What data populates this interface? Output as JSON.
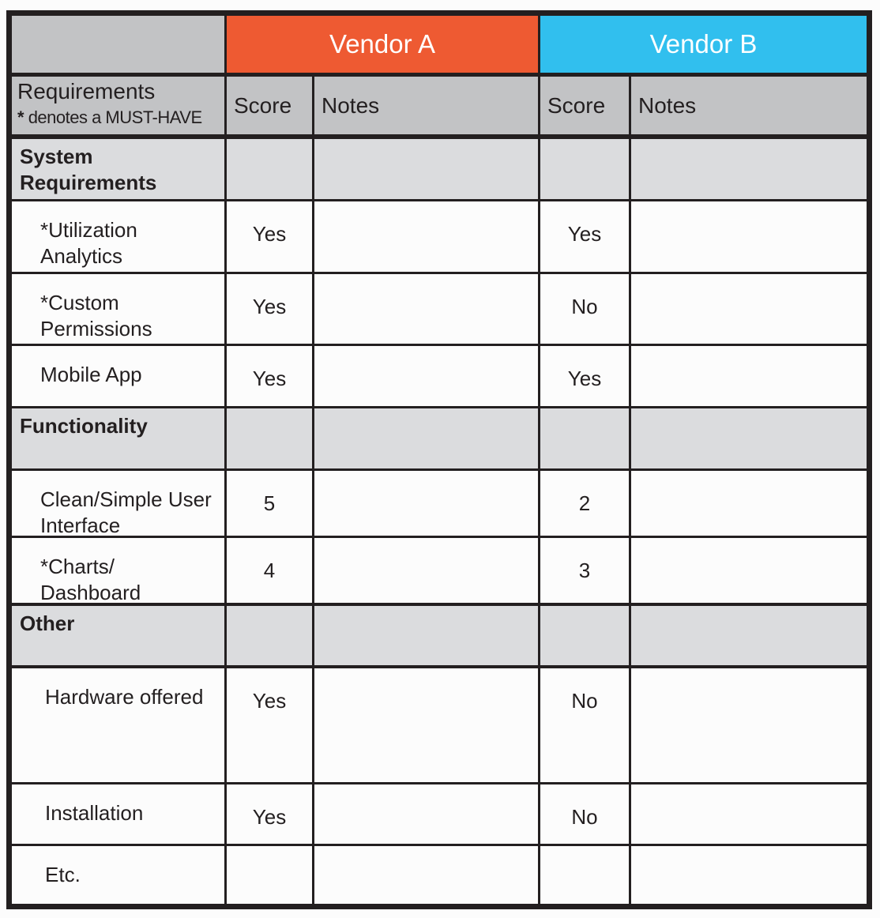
{
  "colors": {
    "vendor_a": "#ee5a32",
    "vendor_b": "#31bfee",
    "header_gray": "#c2c3c5",
    "section_gray": "#dbdcde",
    "border": "#231f20"
  },
  "vendors": [
    {
      "name": "Vendor A"
    },
    {
      "name": "Vendor B"
    }
  ],
  "columns": {
    "requirements": "Requirements",
    "must_have_marker": "*",
    "must_have_note": "denotes a MUST-HAVE",
    "score": "Score",
    "notes": "Notes"
  },
  "rows": [
    {
      "type": "section",
      "label": "System Requirements"
    },
    {
      "type": "item",
      "label_line1": "*Utilization",
      "label_line2": "Analytics",
      "vendor_a_score": "Yes",
      "vendor_a_notes": "",
      "vendor_b_score": "Yes",
      "vendor_b_notes": ""
    },
    {
      "type": "item",
      "label_line1": "*Custom",
      "label_line2": "Permissions",
      "vendor_a_score": "Yes",
      "vendor_a_notes": "",
      "vendor_b_score": "No",
      "vendor_b_notes": ""
    },
    {
      "type": "item",
      "label_line1": "Mobile App",
      "label_line2": "",
      "vendor_a_score": "Yes",
      "vendor_a_notes": "",
      "vendor_b_score": "Yes",
      "vendor_b_notes": ""
    },
    {
      "type": "section",
      "label": "Functionality"
    },
    {
      "type": "item",
      "label_line1": "Clean/Simple User",
      "label_line2": "Interface",
      "vendor_a_score": "5",
      "vendor_a_notes": "",
      "vendor_b_score": "2",
      "vendor_b_notes": ""
    },
    {
      "type": "item",
      "label_line1": "*Charts/",
      "label_line2": "Dashboard",
      "vendor_a_score": "4",
      "vendor_a_notes": "",
      "vendor_b_score": "3",
      "vendor_b_notes": ""
    },
    {
      "type": "section",
      "label": "Other"
    },
    {
      "type": "item",
      "label_line1": "Hardware offered",
      "label_line2": "",
      "vendor_a_score": "Yes",
      "vendor_a_notes": "",
      "vendor_b_score": "No",
      "vendor_b_notes": ""
    },
    {
      "type": "item",
      "label_line1": "Installation",
      "label_line2": "",
      "vendor_a_score": "Yes",
      "vendor_a_notes": "",
      "vendor_b_score": "No",
      "vendor_b_notes": ""
    },
    {
      "type": "item",
      "label_line1": "Etc.",
      "label_line2": "",
      "vendor_a_score": "",
      "vendor_a_notes": "",
      "vendor_b_score": "",
      "vendor_b_notes": ""
    }
  ]
}
